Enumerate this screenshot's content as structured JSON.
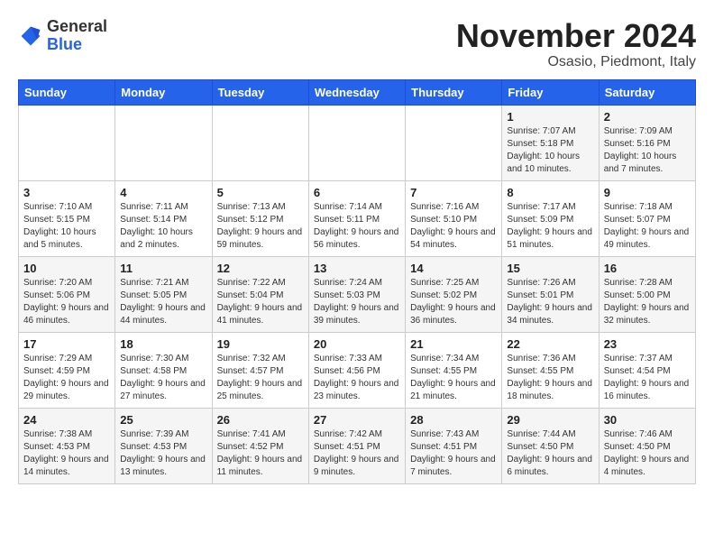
{
  "logo": {
    "general": "General",
    "blue": "Blue"
  },
  "header": {
    "title": "November 2024",
    "location": "Osasio, Piedmont, Italy"
  },
  "weekdays": [
    "Sunday",
    "Monday",
    "Tuesday",
    "Wednesday",
    "Thursday",
    "Friday",
    "Saturday"
  ],
  "weeks": [
    [
      {
        "day": "",
        "info": ""
      },
      {
        "day": "",
        "info": ""
      },
      {
        "day": "",
        "info": ""
      },
      {
        "day": "",
        "info": ""
      },
      {
        "day": "",
        "info": ""
      },
      {
        "day": "1",
        "info": "Sunrise: 7:07 AM\nSunset: 5:18 PM\nDaylight: 10 hours and 10 minutes."
      },
      {
        "day": "2",
        "info": "Sunrise: 7:09 AM\nSunset: 5:16 PM\nDaylight: 10 hours and 7 minutes."
      }
    ],
    [
      {
        "day": "3",
        "info": "Sunrise: 7:10 AM\nSunset: 5:15 PM\nDaylight: 10 hours and 5 minutes."
      },
      {
        "day": "4",
        "info": "Sunrise: 7:11 AM\nSunset: 5:14 PM\nDaylight: 10 hours and 2 minutes."
      },
      {
        "day": "5",
        "info": "Sunrise: 7:13 AM\nSunset: 5:12 PM\nDaylight: 9 hours and 59 minutes."
      },
      {
        "day": "6",
        "info": "Sunrise: 7:14 AM\nSunset: 5:11 PM\nDaylight: 9 hours and 56 minutes."
      },
      {
        "day": "7",
        "info": "Sunrise: 7:16 AM\nSunset: 5:10 PM\nDaylight: 9 hours and 54 minutes."
      },
      {
        "day": "8",
        "info": "Sunrise: 7:17 AM\nSunset: 5:09 PM\nDaylight: 9 hours and 51 minutes."
      },
      {
        "day": "9",
        "info": "Sunrise: 7:18 AM\nSunset: 5:07 PM\nDaylight: 9 hours and 49 minutes."
      }
    ],
    [
      {
        "day": "10",
        "info": "Sunrise: 7:20 AM\nSunset: 5:06 PM\nDaylight: 9 hours and 46 minutes."
      },
      {
        "day": "11",
        "info": "Sunrise: 7:21 AM\nSunset: 5:05 PM\nDaylight: 9 hours and 44 minutes."
      },
      {
        "day": "12",
        "info": "Sunrise: 7:22 AM\nSunset: 5:04 PM\nDaylight: 9 hours and 41 minutes."
      },
      {
        "day": "13",
        "info": "Sunrise: 7:24 AM\nSunset: 5:03 PM\nDaylight: 9 hours and 39 minutes."
      },
      {
        "day": "14",
        "info": "Sunrise: 7:25 AM\nSunset: 5:02 PM\nDaylight: 9 hours and 36 minutes."
      },
      {
        "day": "15",
        "info": "Sunrise: 7:26 AM\nSunset: 5:01 PM\nDaylight: 9 hours and 34 minutes."
      },
      {
        "day": "16",
        "info": "Sunrise: 7:28 AM\nSunset: 5:00 PM\nDaylight: 9 hours and 32 minutes."
      }
    ],
    [
      {
        "day": "17",
        "info": "Sunrise: 7:29 AM\nSunset: 4:59 PM\nDaylight: 9 hours and 29 minutes."
      },
      {
        "day": "18",
        "info": "Sunrise: 7:30 AM\nSunset: 4:58 PM\nDaylight: 9 hours and 27 minutes."
      },
      {
        "day": "19",
        "info": "Sunrise: 7:32 AM\nSunset: 4:57 PM\nDaylight: 9 hours and 25 minutes."
      },
      {
        "day": "20",
        "info": "Sunrise: 7:33 AM\nSunset: 4:56 PM\nDaylight: 9 hours and 23 minutes."
      },
      {
        "day": "21",
        "info": "Sunrise: 7:34 AM\nSunset: 4:55 PM\nDaylight: 9 hours and 21 minutes."
      },
      {
        "day": "22",
        "info": "Sunrise: 7:36 AM\nSunset: 4:55 PM\nDaylight: 9 hours and 18 minutes."
      },
      {
        "day": "23",
        "info": "Sunrise: 7:37 AM\nSunset: 4:54 PM\nDaylight: 9 hours and 16 minutes."
      }
    ],
    [
      {
        "day": "24",
        "info": "Sunrise: 7:38 AM\nSunset: 4:53 PM\nDaylight: 9 hours and 14 minutes."
      },
      {
        "day": "25",
        "info": "Sunrise: 7:39 AM\nSunset: 4:53 PM\nDaylight: 9 hours and 13 minutes."
      },
      {
        "day": "26",
        "info": "Sunrise: 7:41 AM\nSunset: 4:52 PM\nDaylight: 9 hours and 11 minutes."
      },
      {
        "day": "27",
        "info": "Sunrise: 7:42 AM\nSunset: 4:51 PM\nDaylight: 9 hours and 9 minutes."
      },
      {
        "day": "28",
        "info": "Sunrise: 7:43 AM\nSunset: 4:51 PM\nDaylight: 9 hours and 7 minutes."
      },
      {
        "day": "29",
        "info": "Sunrise: 7:44 AM\nSunset: 4:50 PM\nDaylight: 9 hours and 6 minutes."
      },
      {
        "day": "30",
        "info": "Sunrise: 7:46 AM\nSunset: 4:50 PM\nDaylight: 9 hours and 4 minutes."
      }
    ]
  ]
}
